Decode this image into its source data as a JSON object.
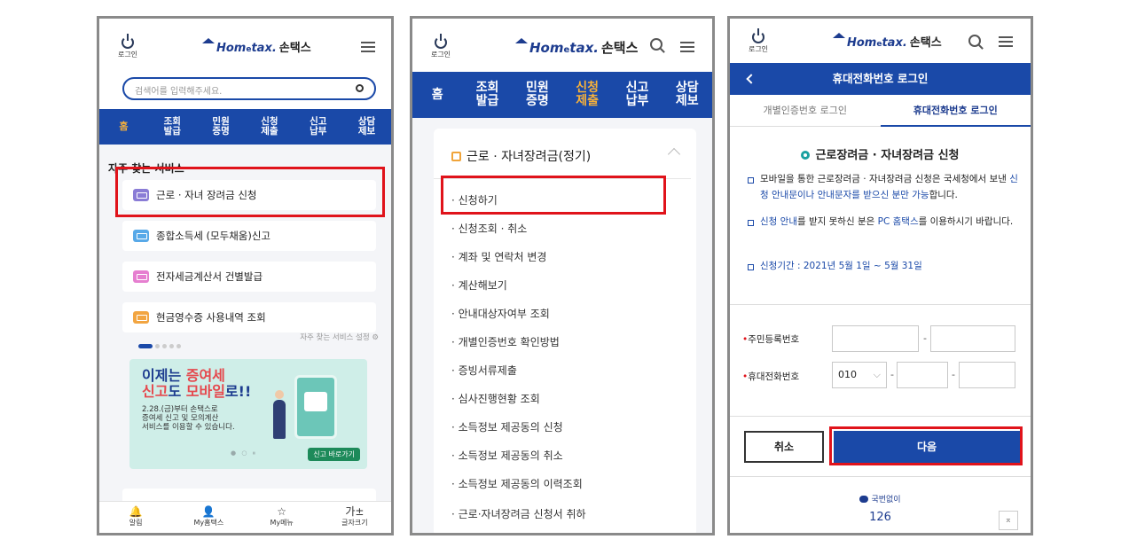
{
  "common": {
    "login_label": "로그인",
    "logo_home": "Hom",
    "logo_e": "e",
    "logo_tax": "tax.",
    "logo_son": "손택스"
  },
  "panel1": {
    "search_placeholder": "검색어를 입력해주세요.",
    "nav": [
      "홈",
      "조회\n발급",
      "민원\n증명",
      "신청\n제출",
      "신고\n납부",
      "상담\n제보"
    ],
    "section_title": "자주 찾는 서비스",
    "services": [
      {
        "label": "근로 · 자녀 장려금 신청",
        "color": "#8a7cd6"
      },
      {
        "label": "종합소득세 (모두채움)신고",
        "color": "#58a9e8"
      },
      {
        "label": "전자세금계산서 건별발급",
        "color": "#e67fd0"
      },
      {
        "label": "현금영수증 사용내역 조회",
        "color": "#f2a541"
      }
    ],
    "setting_label": "자주 찾는 서비스 설정 ⚙",
    "banner": {
      "line1_a": "이제는 ",
      "line1_b": "증여세",
      "line2_a": "신고",
      "line2_b": "도 ",
      "line2_c": "모바일",
      "line2_d": "로!!",
      "line3": "2.28.(금)부터 손택스로",
      "line4": "증여세 신고 및 모의계산",
      "line5": "서비스를 이용할 수 있습니다.",
      "cta": "신고 바로가기",
      "dots": "● ○ ⏸"
    },
    "tabbar": [
      {
        "icon": "🔔",
        "label": "알림"
      },
      {
        "icon": "👤",
        "label": "My홈택스"
      },
      {
        "icon": "☆",
        "label": "My메뉴"
      },
      {
        "icon": "가±",
        "label": "글자크기"
      }
    ]
  },
  "panel2": {
    "nav": [
      "홈",
      "조회\n발급",
      "민원\n증명",
      "신청\n제출",
      "신고\n납부",
      "상담\n제보"
    ],
    "card_title": "근로 · 자녀장려금(정기)",
    "items": [
      "· 신청하기",
      "· 신청조회 · 취소",
      "· 계좌 및 연락처 변경",
      "· 계산해보기",
      "· 안내대상자여부 조회",
      "· 개별인증번호 확인방법",
      "· 증빙서류제출",
      "· 심사진행현황 조회",
      "· 소득정보 제공동의 신청",
      "· 소득정보 제공동의 취소",
      "· 소득정보 제공동의 이력조회",
      "· 근로·자녀장려금 신청서 취하"
    ]
  },
  "panel3": {
    "title": "휴대전화번호 로그인",
    "tabs": [
      "개별인증번호 로그인",
      "휴대전화번호 로그인"
    ],
    "heading": "근로장려금 · 자녀장려금 신청",
    "bullet1_a": "모바일을 통한 근로장려금 · 자녀장려금 신청은 국세청에서 보낸 ",
    "bullet1_b": "신청 안내문이나 안내문자를 받으신 분만 가능",
    "bullet1_c": "합니다.",
    "bullet2_a": "신청 안내",
    "bullet2_b": "를 받지 못하신 분은 ",
    "bullet2_c": "PC 홈택스",
    "bullet2_d": "를 이용하시기 바랍니다.",
    "bullet3": "신청기간 : 2021년 5월 1일 ~ 5월 31일",
    "rrn_label": "주민등록번호",
    "phone_label": "휴대전화번호",
    "phone_prefix": "010",
    "cancel": "취소",
    "next": "다음",
    "ars_label": "국번없이",
    "ars_number": "126",
    "to_top": "⌅"
  }
}
